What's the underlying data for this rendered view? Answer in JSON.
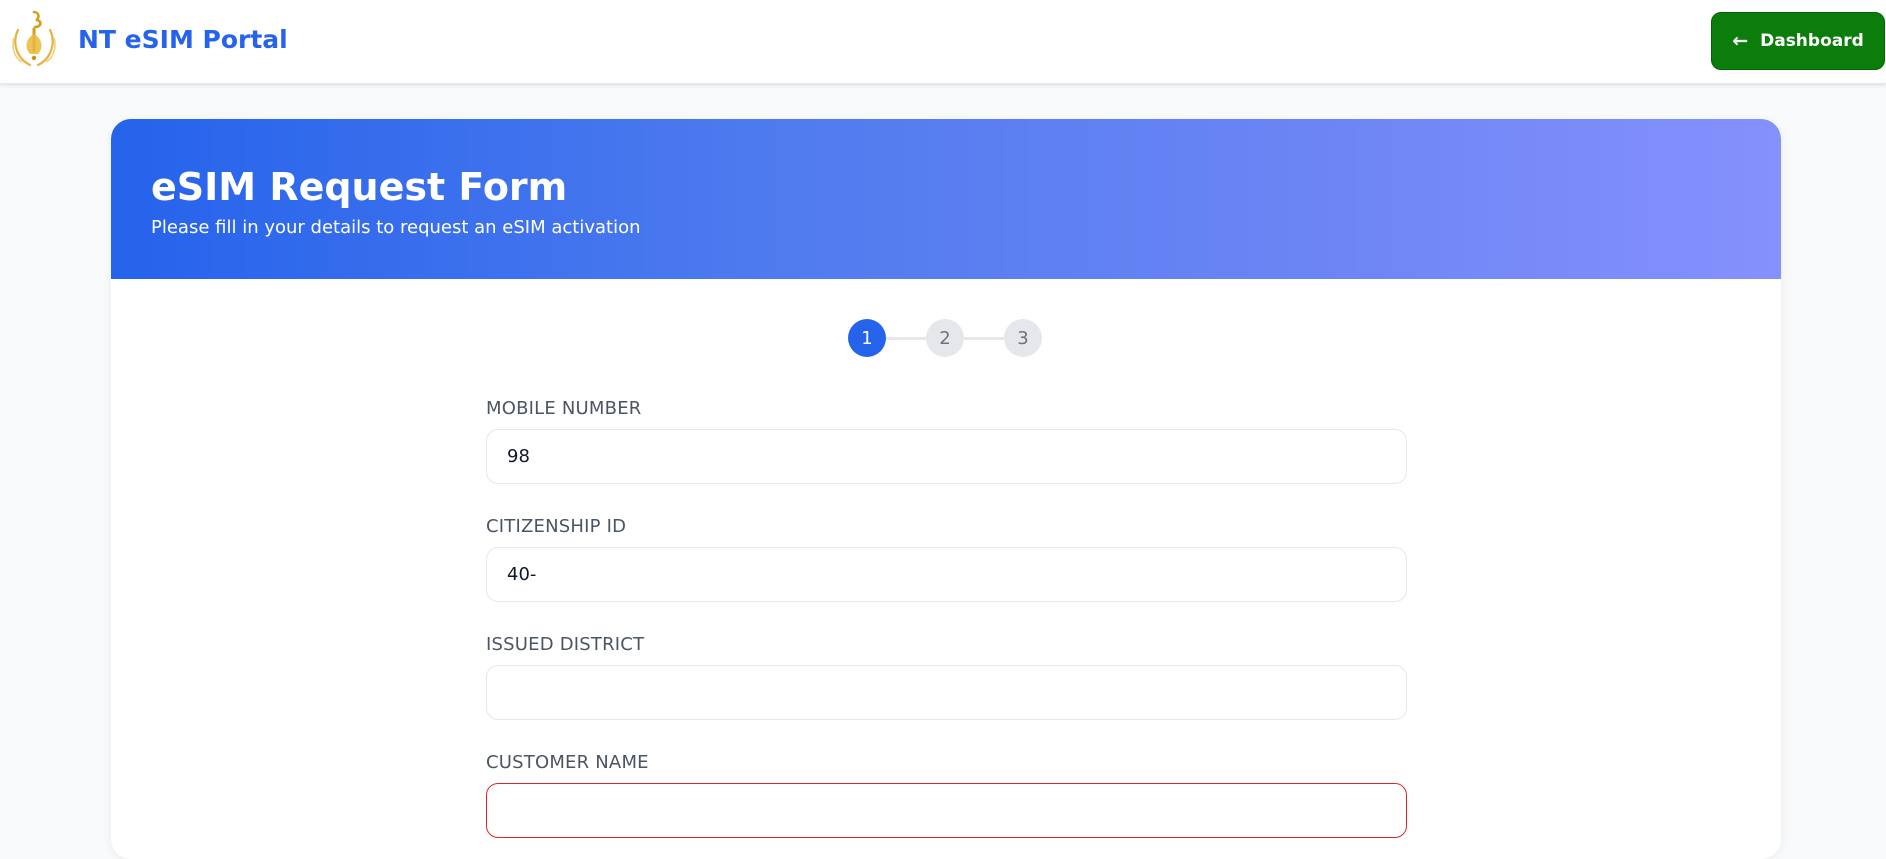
{
  "navbar": {
    "brand_name": "NT eSIM Portal",
    "logo_icon": "nt-logo-icon",
    "dashboard_button": {
      "label": "Dashboard",
      "icon": "arrow-left-icon"
    },
    "button_color": "#0a7d0a",
    "brand_color": "#2563eb"
  },
  "form": {
    "title": "eSIM Request Form",
    "subtitle": "Please fill in your details to request an eSIM activation",
    "header_gradient": [
      "#2563eb",
      "#8591fd"
    ],
    "steps": [
      {
        "number": "1",
        "state": "active"
      },
      {
        "number": "2",
        "state": "inactive"
      },
      {
        "number": "3",
        "state": "inactive"
      }
    ],
    "fields": [
      {
        "label": "MOBILE NUMBER",
        "value": "98",
        "placeholder": ""
      },
      {
        "label": "CITIZENSHIP ID",
        "value": "40-",
        "placeholder": ""
      },
      {
        "label": "ISSUED DISTRICT",
        "value": "",
        "placeholder": ""
      },
      {
        "label": "CUSTOMER NAME",
        "value": "",
        "placeholder": "",
        "state": "error"
      }
    ],
    "error_color": "#dc2626"
  }
}
